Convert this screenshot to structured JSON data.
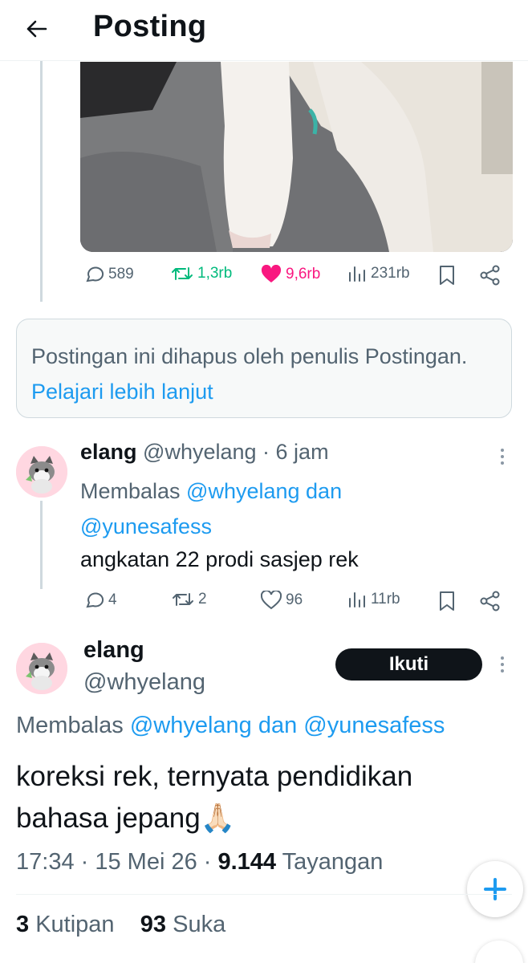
{
  "header": {
    "title": "Posting"
  },
  "post_actions": {
    "replies": "589",
    "reposts": "1,3rb",
    "likes": "9,6rb",
    "views": "231rb"
  },
  "deleted_notice": {
    "text": "Postingan ini dihapus oleh penulis Postingan. ",
    "link": "Pelajari lebih lanjut"
  },
  "reply": {
    "name": "elang",
    "handle": "@whyelang",
    "time": " · 6 jam",
    "replying_prefix": "Membalas ",
    "replying_to": "@whyelang dan @yunesafess",
    "text": "angkatan 22 prodi sasjep rek",
    "actions": {
      "replies": "4",
      "reposts": "2",
      "likes": "96",
      "views": "11rb"
    }
  },
  "main_post": {
    "name": "elang",
    "handle": "@whyelang",
    "follow_label": "Ikuti",
    "replying_prefix": "Membalas ",
    "replying_to": "@whyelang dan @yunesafess",
    "text": "koreksi rek, ternyata pendidikan bahasa jepang🙏🏻",
    "time": "17:34 · 15 Mei 26 · ",
    "views": "9.144",
    "views_label": " Tayangan",
    "quotes_count": "3",
    "quotes_label": " Kutipan",
    "likes_count": "93",
    "likes_label": " Suka"
  },
  "colors": {
    "accent": "#1d9bf0",
    "like": "#f91880",
    "repost": "#00ba7c",
    "text": "#0f1419",
    "muted": "#536471"
  },
  "icons": [
    "back-arrow-icon",
    "reply-icon",
    "repost-icon",
    "heart-icon",
    "views-icon",
    "bookmark-icon",
    "share-icon",
    "more-icon",
    "plus-icon"
  ]
}
